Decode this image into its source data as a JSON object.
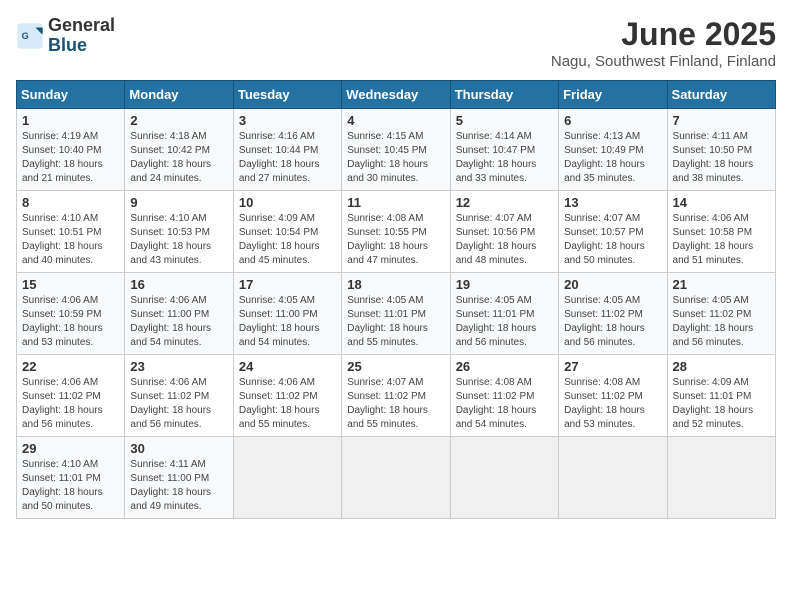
{
  "logo": {
    "general": "General",
    "blue": "Blue"
  },
  "title": {
    "month_year": "June 2025",
    "location": "Nagu, Southwest Finland, Finland"
  },
  "weekdays": [
    "Sunday",
    "Monday",
    "Tuesday",
    "Wednesday",
    "Thursday",
    "Friday",
    "Saturday"
  ],
  "weeks": [
    [
      {
        "day": "1",
        "info": "Sunrise: 4:19 AM\nSunset: 10:40 PM\nDaylight: 18 hours\nand 21 minutes."
      },
      {
        "day": "2",
        "info": "Sunrise: 4:18 AM\nSunset: 10:42 PM\nDaylight: 18 hours\nand 24 minutes."
      },
      {
        "day": "3",
        "info": "Sunrise: 4:16 AM\nSunset: 10:44 PM\nDaylight: 18 hours\nand 27 minutes."
      },
      {
        "day": "4",
        "info": "Sunrise: 4:15 AM\nSunset: 10:45 PM\nDaylight: 18 hours\nand 30 minutes."
      },
      {
        "day": "5",
        "info": "Sunrise: 4:14 AM\nSunset: 10:47 PM\nDaylight: 18 hours\nand 33 minutes."
      },
      {
        "day": "6",
        "info": "Sunrise: 4:13 AM\nSunset: 10:49 PM\nDaylight: 18 hours\nand 35 minutes."
      },
      {
        "day": "7",
        "info": "Sunrise: 4:11 AM\nSunset: 10:50 PM\nDaylight: 18 hours\nand 38 minutes."
      }
    ],
    [
      {
        "day": "8",
        "info": "Sunrise: 4:10 AM\nSunset: 10:51 PM\nDaylight: 18 hours\nand 40 minutes."
      },
      {
        "day": "9",
        "info": "Sunrise: 4:10 AM\nSunset: 10:53 PM\nDaylight: 18 hours\nand 43 minutes."
      },
      {
        "day": "10",
        "info": "Sunrise: 4:09 AM\nSunset: 10:54 PM\nDaylight: 18 hours\nand 45 minutes."
      },
      {
        "day": "11",
        "info": "Sunrise: 4:08 AM\nSunset: 10:55 PM\nDaylight: 18 hours\nand 47 minutes."
      },
      {
        "day": "12",
        "info": "Sunrise: 4:07 AM\nSunset: 10:56 PM\nDaylight: 18 hours\nand 48 minutes."
      },
      {
        "day": "13",
        "info": "Sunrise: 4:07 AM\nSunset: 10:57 PM\nDaylight: 18 hours\nand 50 minutes."
      },
      {
        "day": "14",
        "info": "Sunrise: 4:06 AM\nSunset: 10:58 PM\nDaylight: 18 hours\nand 51 minutes."
      }
    ],
    [
      {
        "day": "15",
        "info": "Sunrise: 4:06 AM\nSunset: 10:59 PM\nDaylight: 18 hours\nand 53 minutes."
      },
      {
        "day": "16",
        "info": "Sunrise: 4:06 AM\nSunset: 11:00 PM\nDaylight: 18 hours\nand 54 minutes."
      },
      {
        "day": "17",
        "info": "Sunrise: 4:05 AM\nSunset: 11:00 PM\nDaylight: 18 hours\nand 54 minutes."
      },
      {
        "day": "18",
        "info": "Sunrise: 4:05 AM\nSunset: 11:01 PM\nDaylight: 18 hours\nand 55 minutes."
      },
      {
        "day": "19",
        "info": "Sunrise: 4:05 AM\nSunset: 11:01 PM\nDaylight: 18 hours\nand 56 minutes."
      },
      {
        "day": "20",
        "info": "Sunrise: 4:05 AM\nSunset: 11:02 PM\nDaylight: 18 hours\nand 56 minutes."
      },
      {
        "day": "21",
        "info": "Sunrise: 4:05 AM\nSunset: 11:02 PM\nDaylight: 18 hours\nand 56 minutes."
      }
    ],
    [
      {
        "day": "22",
        "info": "Sunrise: 4:06 AM\nSunset: 11:02 PM\nDaylight: 18 hours\nand 56 minutes."
      },
      {
        "day": "23",
        "info": "Sunrise: 4:06 AM\nSunset: 11:02 PM\nDaylight: 18 hours\nand 56 minutes."
      },
      {
        "day": "24",
        "info": "Sunrise: 4:06 AM\nSunset: 11:02 PM\nDaylight: 18 hours\nand 55 minutes."
      },
      {
        "day": "25",
        "info": "Sunrise: 4:07 AM\nSunset: 11:02 PM\nDaylight: 18 hours\nand 55 minutes."
      },
      {
        "day": "26",
        "info": "Sunrise: 4:08 AM\nSunset: 11:02 PM\nDaylight: 18 hours\nand 54 minutes."
      },
      {
        "day": "27",
        "info": "Sunrise: 4:08 AM\nSunset: 11:02 PM\nDaylight: 18 hours\nand 53 minutes."
      },
      {
        "day": "28",
        "info": "Sunrise: 4:09 AM\nSunset: 11:01 PM\nDaylight: 18 hours\nand 52 minutes."
      }
    ],
    [
      {
        "day": "29",
        "info": "Sunrise: 4:10 AM\nSunset: 11:01 PM\nDaylight: 18 hours\nand 50 minutes."
      },
      {
        "day": "30",
        "info": "Sunrise: 4:11 AM\nSunset: 11:00 PM\nDaylight: 18 hours\nand 49 minutes."
      },
      {
        "day": "",
        "info": ""
      },
      {
        "day": "",
        "info": ""
      },
      {
        "day": "",
        "info": ""
      },
      {
        "day": "",
        "info": ""
      },
      {
        "day": "",
        "info": ""
      }
    ]
  ]
}
